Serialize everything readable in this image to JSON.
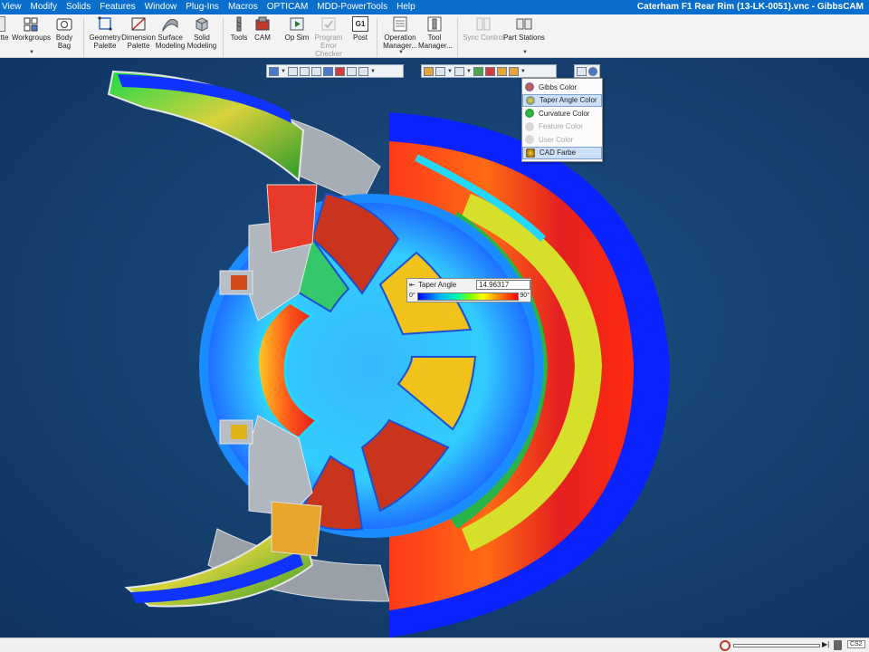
{
  "window": {
    "title": "Caterham F1 Rear Rim (13-LK-0051).vnc - GibbsCAM",
    "title_bar_color": "#0a6fcc"
  },
  "menu": [
    "View",
    "Modify",
    "Solids",
    "Features",
    "Window",
    "Plug-Ins",
    "Macros",
    "OPTICAM",
    "MDD-PowerTools",
    "Help"
  ],
  "ribbon": {
    "partial_item": "tte",
    "workgroups": "Workgroups",
    "body_bag": "Body Bag",
    "geometry_palette_1": "Geometry",
    "geometry_palette_2": "Palette",
    "dimension_palette_1": "Dimension",
    "dimension_palette_2": "Palette",
    "surface_modeling_1": "Surface",
    "surface_modeling_2": "Modeling",
    "solid_modeling_1": "Solid",
    "solid_modeling_2": "Modeling",
    "tools": "Tools",
    "cam": "CAM",
    "op_sim": "Op Sim",
    "program_error_checker_1": "Program",
    "program_error_checker_2": "Error Checker",
    "post": "Post",
    "post_badge": "G1",
    "operation_manager_1": "Operation",
    "operation_manager_2": "Manager...",
    "tool_manager_1": "Tool",
    "tool_manager_2": "Manager...",
    "sync_control": "Sync Control",
    "part_stations": "Part Stations"
  },
  "color_menu": {
    "items": [
      {
        "label": "Gibbs Color",
        "state": "enabled"
      },
      {
        "label": "Taper Angle Color",
        "state": "selected"
      },
      {
        "label": "Curvature Color",
        "state": "enabled"
      },
      {
        "label": "Feature Color",
        "state": "disabled"
      },
      {
        "label": "User Color",
        "state": "disabled"
      },
      {
        "label": "CAD Farbe",
        "state": "highlighted"
      }
    ]
  },
  "taper_angle": {
    "label": "Taper Angle",
    "value": "14.96317",
    "min": "0°",
    "max": "90°"
  },
  "status": {
    "coordinate_system": "CS2"
  },
  "colors": {
    "viewport_bg": "#15406f",
    "highlight": "#cde0f7"
  }
}
